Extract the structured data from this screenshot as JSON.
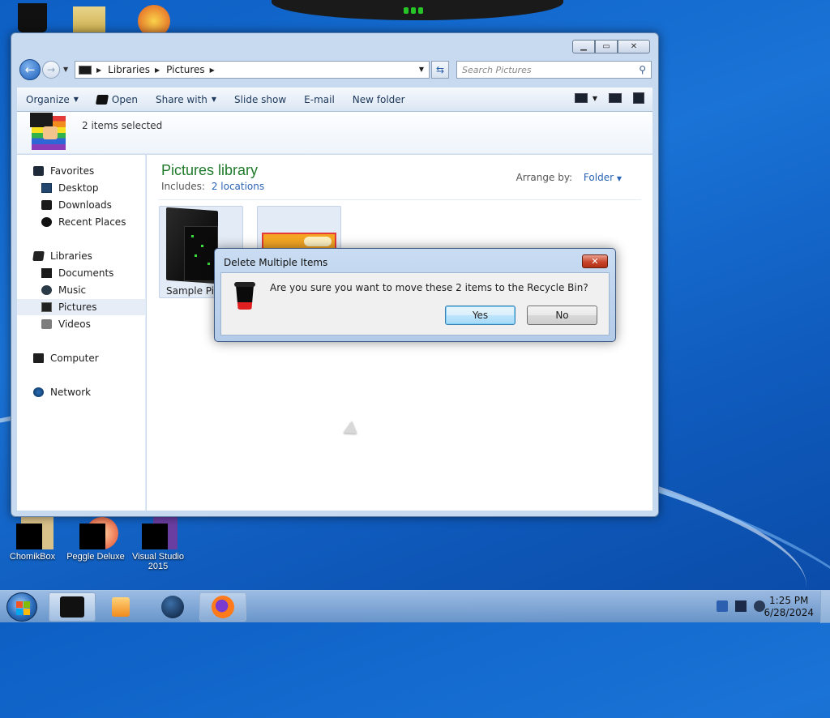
{
  "explorer": {
    "address": {
      "crumbs": [
        "Libraries",
        "Pictures"
      ]
    },
    "search": {
      "placeholder": "Search Pictures"
    },
    "toolbar": {
      "organize": "Organize",
      "open": "Open",
      "share_with": "Share with",
      "slide_show": "Slide show",
      "email": "E-mail",
      "new_folder": "New folder"
    },
    "details": {
      "selection_text": "2 items selected"
    },
    "nav": {
      "favorites": "Favorites",
      "desktop": "Desktop",
      "downloads": "Downloads",
      "recent_places": "Recent Places",
      "libraries": "Libraries",
      "documents": "Documents",
      "music": "Music",
      "pictures": "Pictures",
      "videos": "Videos",
      "computer": "Computer",
      "network": "Network"
    },
    "library": {
      "title": "Pictures library",
      "includes_label": "Includes:",
      "includes_link": "2 locations",
      "arrange_label": "Arrange by:",
      "arrange_value": "Folder"
    },
    "items": [
      {
        "label": "Sample Pic"
      },
      {
        "label": ""
      }
    ]
  },
  "dialog": {
    "title": "Delete Multiple Items",
    "message": "Are you sure you want to move these 2 items to the Recycle Bin?",
    "yes": "Yes",
    "no": "No"
  },
  "desktop_icons": {
    "chomikbox": "ChomikBox",
    "peggle": "Peggle Deluxe",
    "vs_line1": "Visual Studio",
    "vs_line2": "2015"
  },
  "taskbar": {
    "time": "1:25 PM",
    "date": "6/28/2024"
  },
  "icons": {
    "back": "back-arrow-icon",
    "forward": "forward-arrow-icon",
    "refresh": "refresh-icon",
    "search": "search-icon",
    "close": "close-icon",
    "recycle": "recycle-bin-icon"
  },
  "colors": {
    "desktop_bg": "#1a73d6",
    "library_title": "#1f7a2a",
    "link": "#2b63b6",
    "close_button": "#c8452c"
  }
}
